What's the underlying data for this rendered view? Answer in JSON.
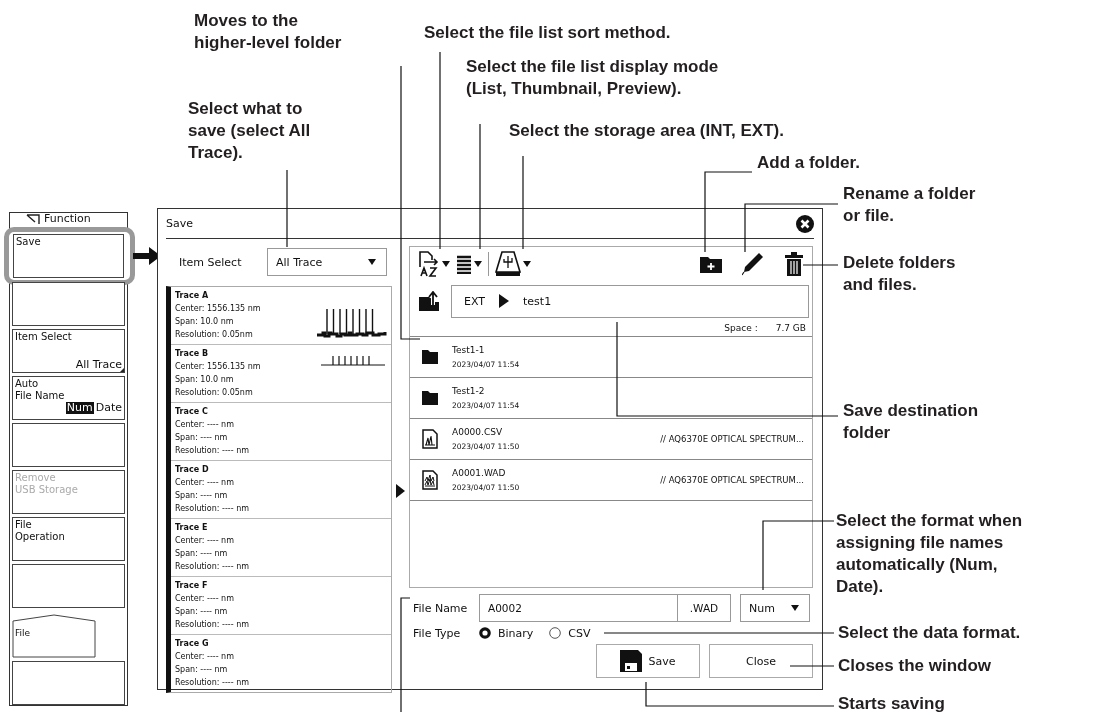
{
  "side_menu": {
    "header": "Function",
    "keys": [
      {
        "kind": "softkey",
        "lines": [
          "Save"
        ],
        "highlighted": true
      },
      {
        "kind": "blank",
        "highlighted": false
      },
      {
        "kind": "softkey",
        "lines": [
          "Item Select"
        ],
        "value": "All Trace",
        "highlighted": false
      },
      {
        "kind": "softkey",
        "lines": [
          "Auto",
          "File Name"
        ],
        "options": [
          {
            "label": "Num",
            "selected": true
          },
          {
            "label": "Date",
            "selected": false
          }
        ],
        "highlighted": false
      },
      {
        "kind": "blank",
        "highlighted": false
      },
      {
        "kind": "softkey",
        "lines": [
          "Remove",
          "USB Storage"
        ],
        "disabled": true,
        "highlighted": false
      },
      {
        "kind": "softkey",
        "lines": [
          "File",
          "Operation"
        ],
        "highlighted": false
      },
      {
        "kind": "blank",
        "highlighted": false
      },
      {
        "kind": "tab",
        "lines": [
          "File"
        ],
        "highlighted": false
      },
      {
        "kind": "blank",
        "highlighted": false
      }
    ]
  },
  "dialog": {
    "title": "Save",
    "item_select": {
      "label": "Item Select",
      "value": "All Trace"
    },
    "traces": [
      {
        "name": "Trace A",
        "center": "Center: 1556.135 nm",
        "span": "Span: 10.0 nm",
        "resolution": "Resolution: 0.05nm",
        "kind": "full"
      },
      {
        "name": "Trace B",
        "center": "Center: 1556.135 nm",
        "span": "Span: 10.0 nm",
        "resolution": "Resolution: 0.05nm",
        "kind": "small"
      },
      {
        "name": "Trace C",
        "center": "Center: ---- nm",
        "span": "Span: ---- nm",
        "resolution": "Resolution: ---- nm"
      },
      {
        "name": "Trace D",
        "center": "Center: ---- nm",
        "span": "Span: ---- nm",
        "resolution": "Resolution: ---- nm"
      },
      {
        "name": "Trace E",
        "center": "Center: ---- nm",
        "span": "Span: ---- nm",
        "resolution": "Resolution: ---- nm"
      },
      {
        "name": "Trace F",
        "center": "Center: ---- nm",
        "span": "Span: ---- nm",
        "resolution": "Resolution: ---- nm"
      },
      {
        "name": "Trace G",
        "center": "Center: ---- nm",
        "span": "Span: ---- nm",
        "resolution": "Resolution: ---- nm"
      }
    ],
    "browser": {
      "path": [
        "EXT",
        "test1"
      ],
      "space_label": "Space :",
      "space_value": "7.7 GB",
      "files": [
        {
          "kind": "folder",
          "name": "Test1-1",
          "date": "2023/04/07 11:54"
        },
        {
          "kind": "folder",
          "name": "Test1-2",
          "date": "2023/04/07 11:54"
        },
        {
          "kind": "csv",
          "name": "A0000.CSV",
          "date": "2023/04/07 11:50",
          "comment": "// AQ6370E OPTICAL SPECTRUM..."
        },
        {
          "kind": "wad",
          "name": "A0001.WAD",
          "date": "2023/04/07 11:50",
          "comment": "// AQ6370E OPTICAL SPECTRUM..."
        }
      ]
    },
    "file_name": {
      "label": "File Name",
      "value": "A0002",
      "extension": ".WAD",
      "format": "Num"
    },
    "file_type": {
      "label": "File Type",
      "options": [
        {
          "label": "Binary",
          "selected": true
        },
        {
          "label": "CSV",
          "selected": false
        }
      ]
    },
    "buttons": [
      {
        "kind": "save",
        "label": "Save"
      },
      {
        "kind": "close",
        "label": "Close"
      }
    ]
  },
  "callouts": [
    {
      "lines": [
        "Moves to the",
        "higher-level folder"
      ]
    },
    {
      "lines": [
        "Select the file list sort method."
      ]
    },
    {
      "lines": [
        "Select the file list display mode",
        "(List, Thumbnail, Preview)."
      ]
    },
    {
      "lines": [
        "Select what to",
        "save (select All",
        "Trace)."
      ]
    },
    {
      "lines": [
        "Select the storage area (INT, EXT)."
      ]
    },
    {
      "lines": [
        "Add a folder."
      ]
    },
    {
      "lines": [
        "Rename a folder",
        "or file."
      ]
    },
    {
      "lines": [
        "Delete folders",
        "and files."
      ]
    },
    {
      "lines": [
        "Save destination",
        "folder"
      ]
    },
    {
      "lines": [
        "Select the format when",
        "assigning file names",
        "automatically (Num,",
        "Date)."
      ]
    },
    {
      "lines": [
        "Select the data format."
      ]
    },
    {
      "lines": [
        "Closes the window"
      ]
    },
    {
      "lines": [
        "Starts saving"
      ]
    }
  ]
}
